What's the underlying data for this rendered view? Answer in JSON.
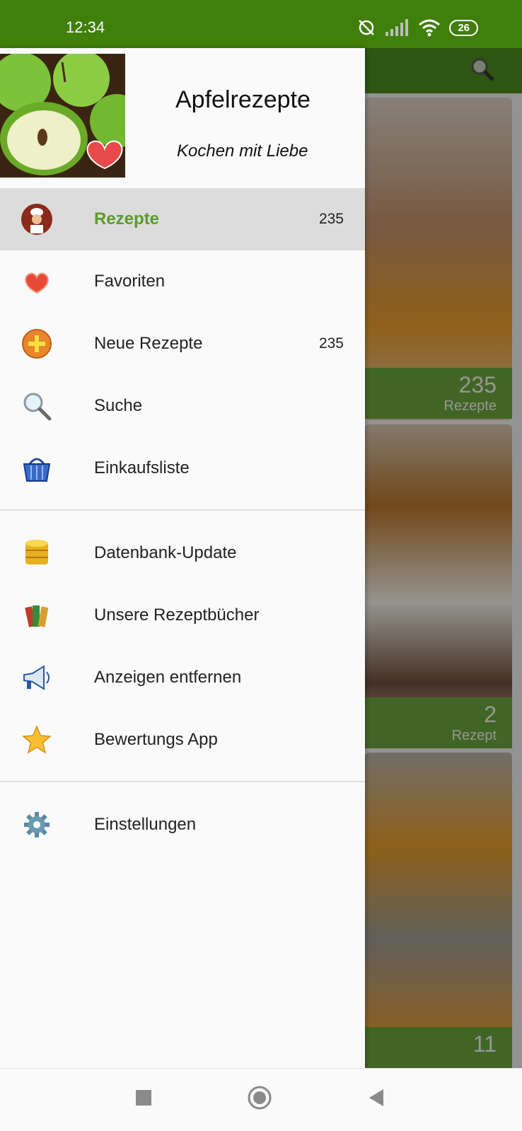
{
  "status_bar": {
    "time": "12:34",
    "battery": "26"
  },
  "drawer_header": {
    "title": "Apfelrezepte",
    "subtitle": "Kochen mit Liebe"
  },
  "menu_primary": [
    {
      "label": "Rezepte",
      "count": "235",
      "icon": "chef-icon",
      "active": true
    },
    {
      "label": "Favoriten",
      "count": "",
      "icon": "heart-icon"
    },
    {
      "label": "Neue Rezepte",
      "count": "235",
      "icon": "plus-badge-icon"
    },
    {
      "label": "Suche",
      "count": "",
      "icon": "magnifier-icon"
    },
    {
      "label": "Einkaufsliste",
      "count": "",
      "icon": "basket-icon"
    }
  ],
  "menu_secondary": [
    {
      "label": "Datenbank-Update",
      "icon": "database-icon"
    },
    {
      "label": "Unsere Rezeptbücher",
      "icon": "books-icon"
    },
    {
      "label": "Anzeigen entfernen",
      "icon": "megaphone-icon"
    },
    {
      "label": "Bewertungs App",
      "icon": "star-icon"
    }
  ],
  "menu_tertiary": [
    {
      "label": "Einstellungen",
      "icon": "gear-icon"
    }
  ],
  "background_cards": [
    {
      "count": "235",
      "label": "Rezepte"
    },
    {
      "count": "2",
      "label": "Rezept"
    },
    {
      "count": "11",
      "label": ""
    }
  ],
  "colors": {
    "status_bar": "#3f7f0a",
    "accent": "#5a9d2b",
    "active_row": "#dcdcdc"
  }
}
